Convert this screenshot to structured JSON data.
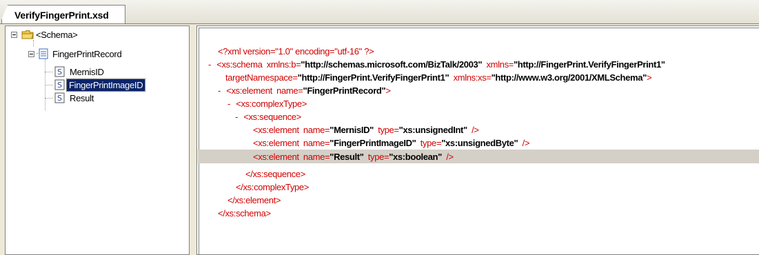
{
  "tab": {
    "title": "VerifyFingerPrint.xsd"
  },
  "tree": {
    "schema_label": "<Schema>",
    "record_label": "FingerPrintRecord",
    "fields": [
      "MernisID",
      "FingerPrintImageID",
      "Result"
    ]
  },
  "code": {
    "l1": "<?xml version=\"1.0\" encoding=\"utf-16\" ?>",
    "l2": {
      "dash": "-",
      "open": "<xs:schema",
      "a1": "xmlns:b",
      "eq": "=",
      "v1": "\"http://schemas.microsoft.com/BizTalk/2003\"",
      "a2": "xmlns",
      "v2": "\"http://FingerPrint.VerifyFingerPrint1\""
    },
    "l3": {
      "a1": "targetNamespace",
      "eq": "=",
      "v1": "\"http://FingerPrint.VerifyFingerPrint1\"",
      "a2": "xmlns:xs",
      "v2": "\"http://www.w3.org/2001/XMLSchema\"",
      "close": ">"
    },
    "l4": {
      "dash": "-",
      "open": "<xs:element",
      "a1": "name",
      "eq": "=",
      "v1": "\"FingerPrintRecord\"",
      "close": ">"
    },
    "l5": {
      "dash": "-",
      "text": "<xs:complexType>"
    },
    "l6": {
      "dash": "-",
      "text": "<xs:sequence>"
    },
    "l7": {
      "open": "<xs:element",
      "a1": "name",
      "v1": "\"MernisID\"",
      "a2": "type",
      "v2": "\"xs:unsignedInt\"",
      "close": "/>"
    },
    "l8": {
      "open": "<xs:element",
      "a1": "name",
      "v1": "\"FingerPrintImageID\"",
      "a2": "type",
      "v2": "\"xs:unsignedByte\"",
      "close": "/>"
    },
    "l9": {
      "open": "<xs:element",
      "a1": "name",
      "v1": "\"Result\"",
      "a2": "type",
      "v2": "\"xs:boolean\"",
      "close": "/>"
    },
    "l10": "</xs:sequence>",
    "l11": "</xs:complexType>",
    "l12": "</xs:element>",
    "l13": "</xs:schema>"
  },
  "colors": {
    "tag": "#d00000",
    "value": "#000000",
    "selection": "#0a246a",
    "highlight": "#d4d0c8"
  }
}
